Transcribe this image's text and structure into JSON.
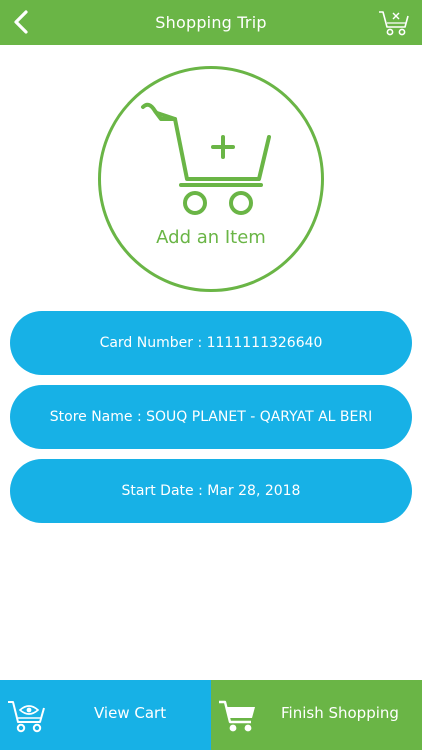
{
  "header": {
    "title": "Shopping Trip",
    "back_icon": "chevron-left-icon",
    "clear_cart_icon": "cart-remove-icon"
  },
  "add_item": {
    "label": "Add an Item",
    "icon": "cart-add-icon"
  },
  "info": {
    "card_number": "Card Number : 1111111326640",
    "store_name": "Store Name : SOUQ PLANET - QARYAT AL BERI",
    "start_date": "Start Date : Mar 28, 2018"
  },
  "bottom": {
    "view_cart_label": "View Cart",
    "view_cart_icon": "cart-view-icon",
    "finish_label": "Finish Shopping",
    "finish_icon": "cart-icon"
  },
  "colors": {
    "green": "#6ab546",
    "blue": "#17b1e6",
    "white": "#ffffff"
  }
}
